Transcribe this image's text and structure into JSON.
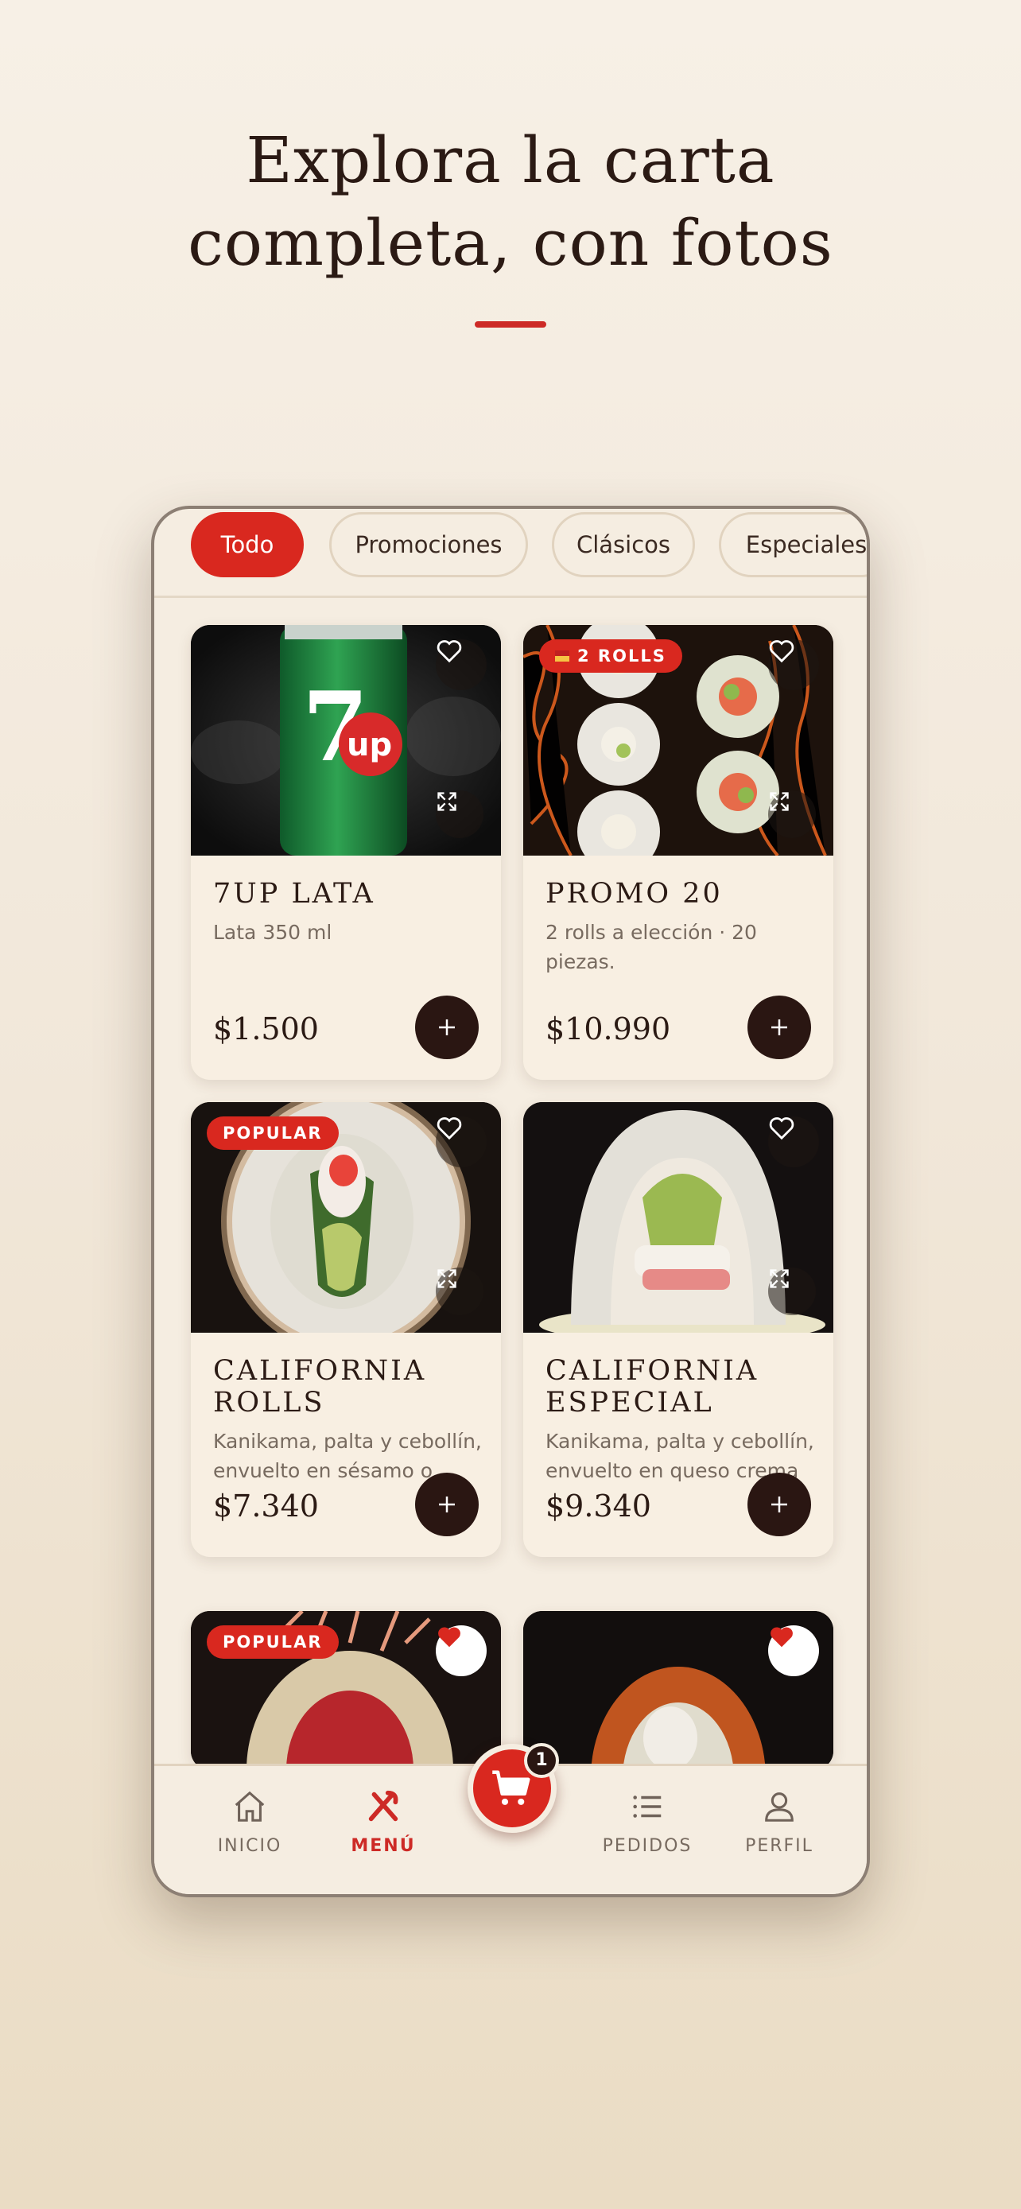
{
  "headline": {
    "line1": "Explora la carta",
    "line2": "completa, con fotos"
  },
  "colors": {
    "accent": "#d9281f",
    "dark": "#2a1612",
    "cream": "#f5ede1"
  },
  "chips": [
    {
      "label": "Todo",
      "active": true
    },
    {
      "label": "Promociones",
      "active": false
    },
    {
      "label": "Clásicos",
      "active": false
    },
    {
      "label": "Especiales",
      "active": false
    }
  ],
  "products": [
    {
      "name": "7UP LATA",
      "description": "Lata 350 ml",
      "price": "$1.500",
      "badge": "",
      "favorite": false,
      "icon": "soda-can-photo"
    },
    {
      "name": "PROMO 20",
      "description": "2 rolls a elección · 20 piezas.",
      "price": "$10.990",
      "badge": "2 ROLLS",
      "favorite": false,
      "icon": "sushi-rolls-photo"
    },
    {
      "name": "CALIFORNIA ROLLS",
      "description": "Kanikama, palta y cebollín, envuelto en sésamo o cib...",
      "price": "$7.340",
      "badge": "POPULAR",
      "favorite": false,
      "icon": "california-roll-photo"
    },
    {
      "name": "CALIFORNIA ESPECIAL",
      "description": "Kanikama, palta y cebollín, envuelto en queso crema ...",
      "price": "$9.340",
      "badge": "",
      "favorite": false,
      "icon": "california-especial-photo"
    },
    {
      "name": "",
      "description": "",
      "price": "",
      "badge": "POPULAR",
      "favorite": true,
      "icon": "tuna-roll-photo"
    },
    {
      "name": "",
      "description": "",
      "price": "",
      "badge": "",
      "favorite": true,
      "icon": "crispy-roll-photo"
    }
  ],
  "nav": {
    "inicio": "INICIO",
    "menu": "MENÚ",
    "pedidos": "PEDIDOS",
    "perfil": "PERFIL",
    "cart_count": "1"
  }
}
